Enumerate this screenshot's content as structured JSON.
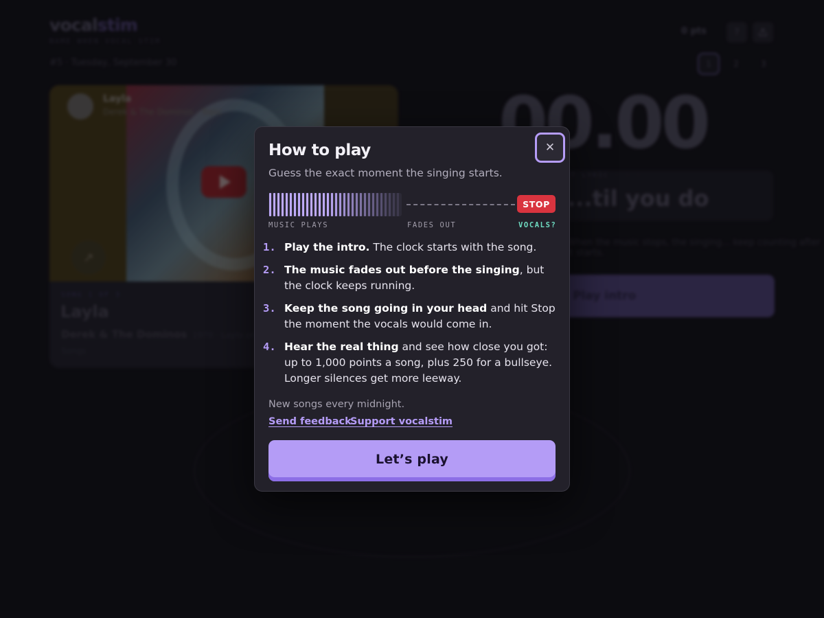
{
  "app": {
    "logo_main": "vocal",
    "logo_accent": "stim",
    "tagline": "NAME WHEN VOCAL STIM",
    "dateline": "#5 · Tuesday, September 30",
    "points": "0 pts",
    "top_icons": [
      "?",
      "share"
    ],
    "rounds": [
      "1",
      "2",
      "3"
    ],
    "active_round": "1"
  },
  "video": {
    "channel_title": "Layla",
    "channel_sub": "Derek & The Dominos · Topic"
  },
  "song": {
    "meta": "SONG 1 OF 3",
    "title": "Layla",
    "artist": "Derek & The Dominos",
    "year": "1970 · Layla and other",
    "extra": "Songs"
  },
  "game": {
    "timer": "00.00",
    "lyric_label": "FIRST LYRIC · · ·",
    "lyric": "...til you do",
    "hint": "When the music stops, the singing... keep counting after it starts.",
    "play_intro": "Play intro"
  },
  "modal": {
    "title": "How to play",
    "subtitle": "Guess the exact moment the singing starts.",
    "close_label": "✕",
    "stop_badge": "STOP",
    "wave_labels": {
      "music": "MUSIC PLAYS",
      "fade": "FADES OUT",
      "vocals": "VOCALS?"
    },
    "steps": [
      {
        "num": "1.",
        "bold": "Play the intro.",
        "rest": " The clock starts with the song."
      },
      {
        "num": "2.",
        "bold": "The music fades out before the singing",
        "rest": ", but the clock keeps running."
      },
      {
        "num": "3.",
        "bold": "Keep the song going in your head",
        "rest": " and hit Stop the moment the vocals would come in."
      },
      {
        "num": "4.",
        "bold": "Hear the real thing",
        "rest": " and see how close you got: up to 1,000 points a song, plus 250 for a bullseye. Longer silences get more leeway."
      }
    ],
    "note": "New songs every midnight.",
    "link_feedback": "Send feedback",
    "link_support": "Support vocalstim",
    "cta": "Let’s play"
  },
  "colors": {
    "accent": "#b49cf6",
    "stop": "#d9343f",
    "vocals": "#6fdcc2",
    "modal_bg": "#23212a"
  }
}
